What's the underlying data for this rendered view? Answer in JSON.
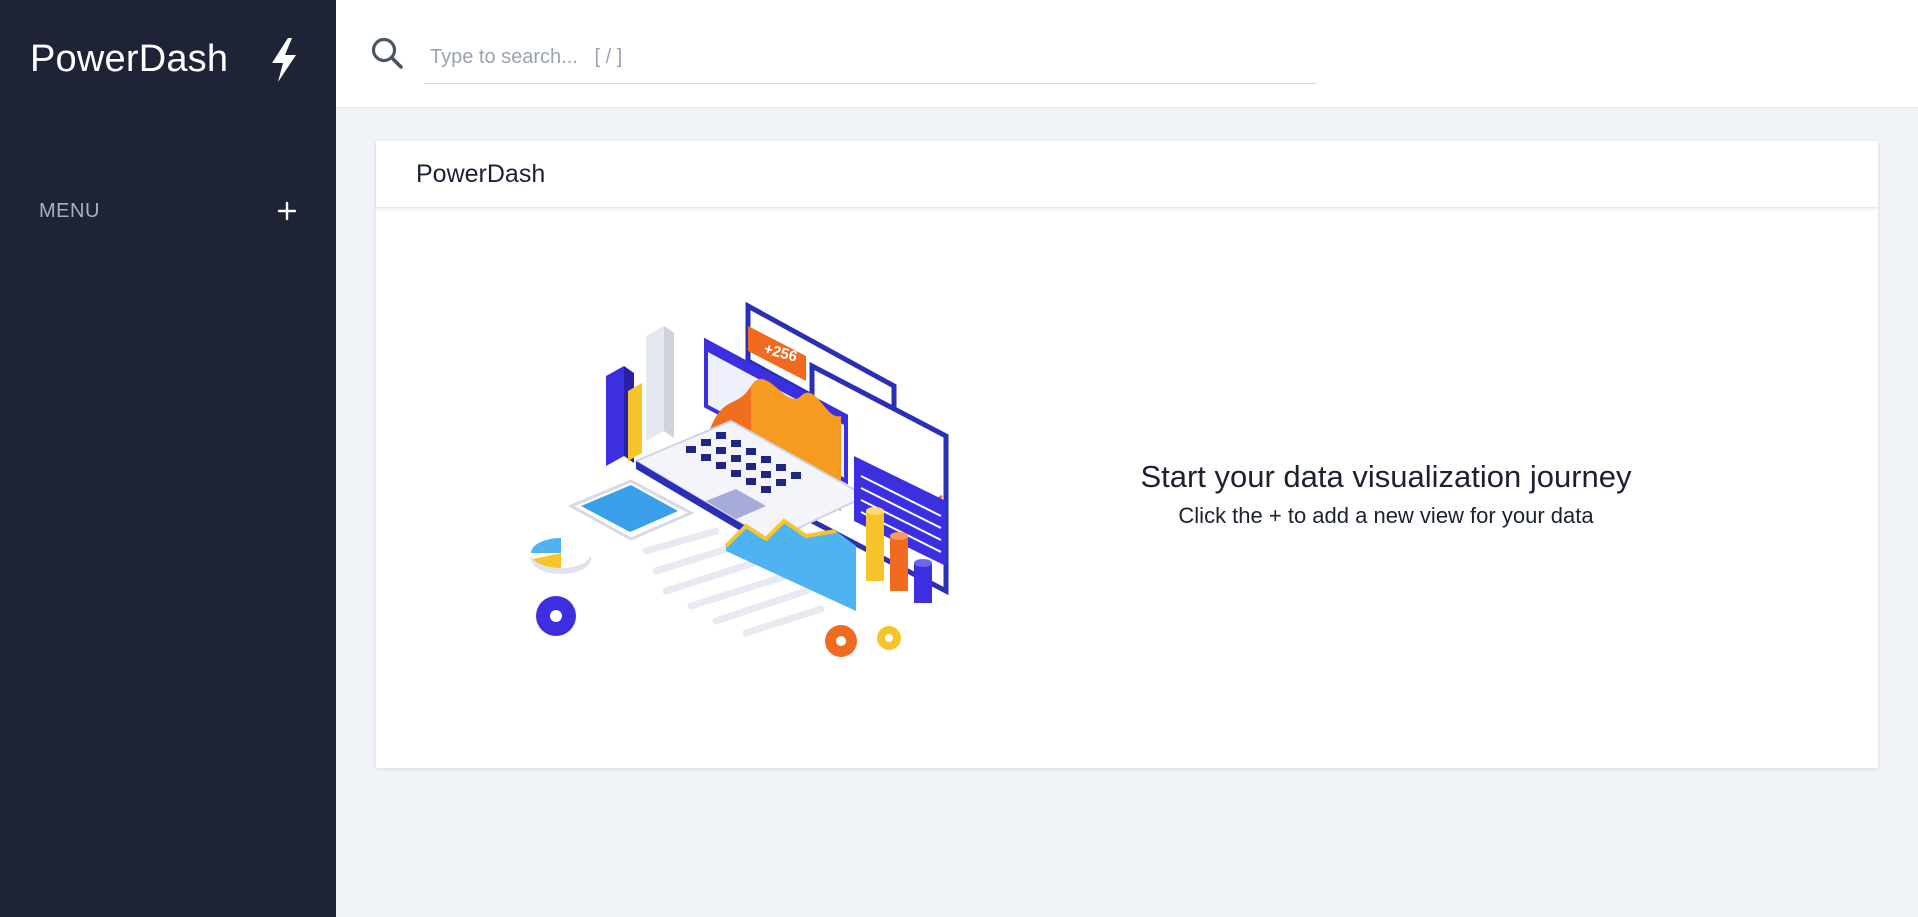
{
  "app": {
    "name": "PowerDash"
  },
  "sidebar": {
    "brand": "PowerDash",
    "brand_icon": "lightning-bolt-icon",
    "menu_label": "MENU",
    "menu_add_icon": "plus-icon"
  },
  "header": {
    "search_icon": "search-icon",
    "search_placeholder": "Type to search...   [ / ]",
    "search_value": ""
  },
  "card": {
    "title": "PowerDash",
    "empty_state": {
      "illustration_icon": "data-visualization-illustration",
      "title": "Start your data visualization journey",
      "subtitle": "Click the + to add a new view for your data"
    }
  },
  "colors": {
    "sidebar_bg": "#1e2435",
    "page_bg": "#f0f3f7",
    "accent_blue": "#3b2fe0",
    "accent_orange": "#f06a1f",
    "accent_yellow": "#f7c42b"
  }
}
